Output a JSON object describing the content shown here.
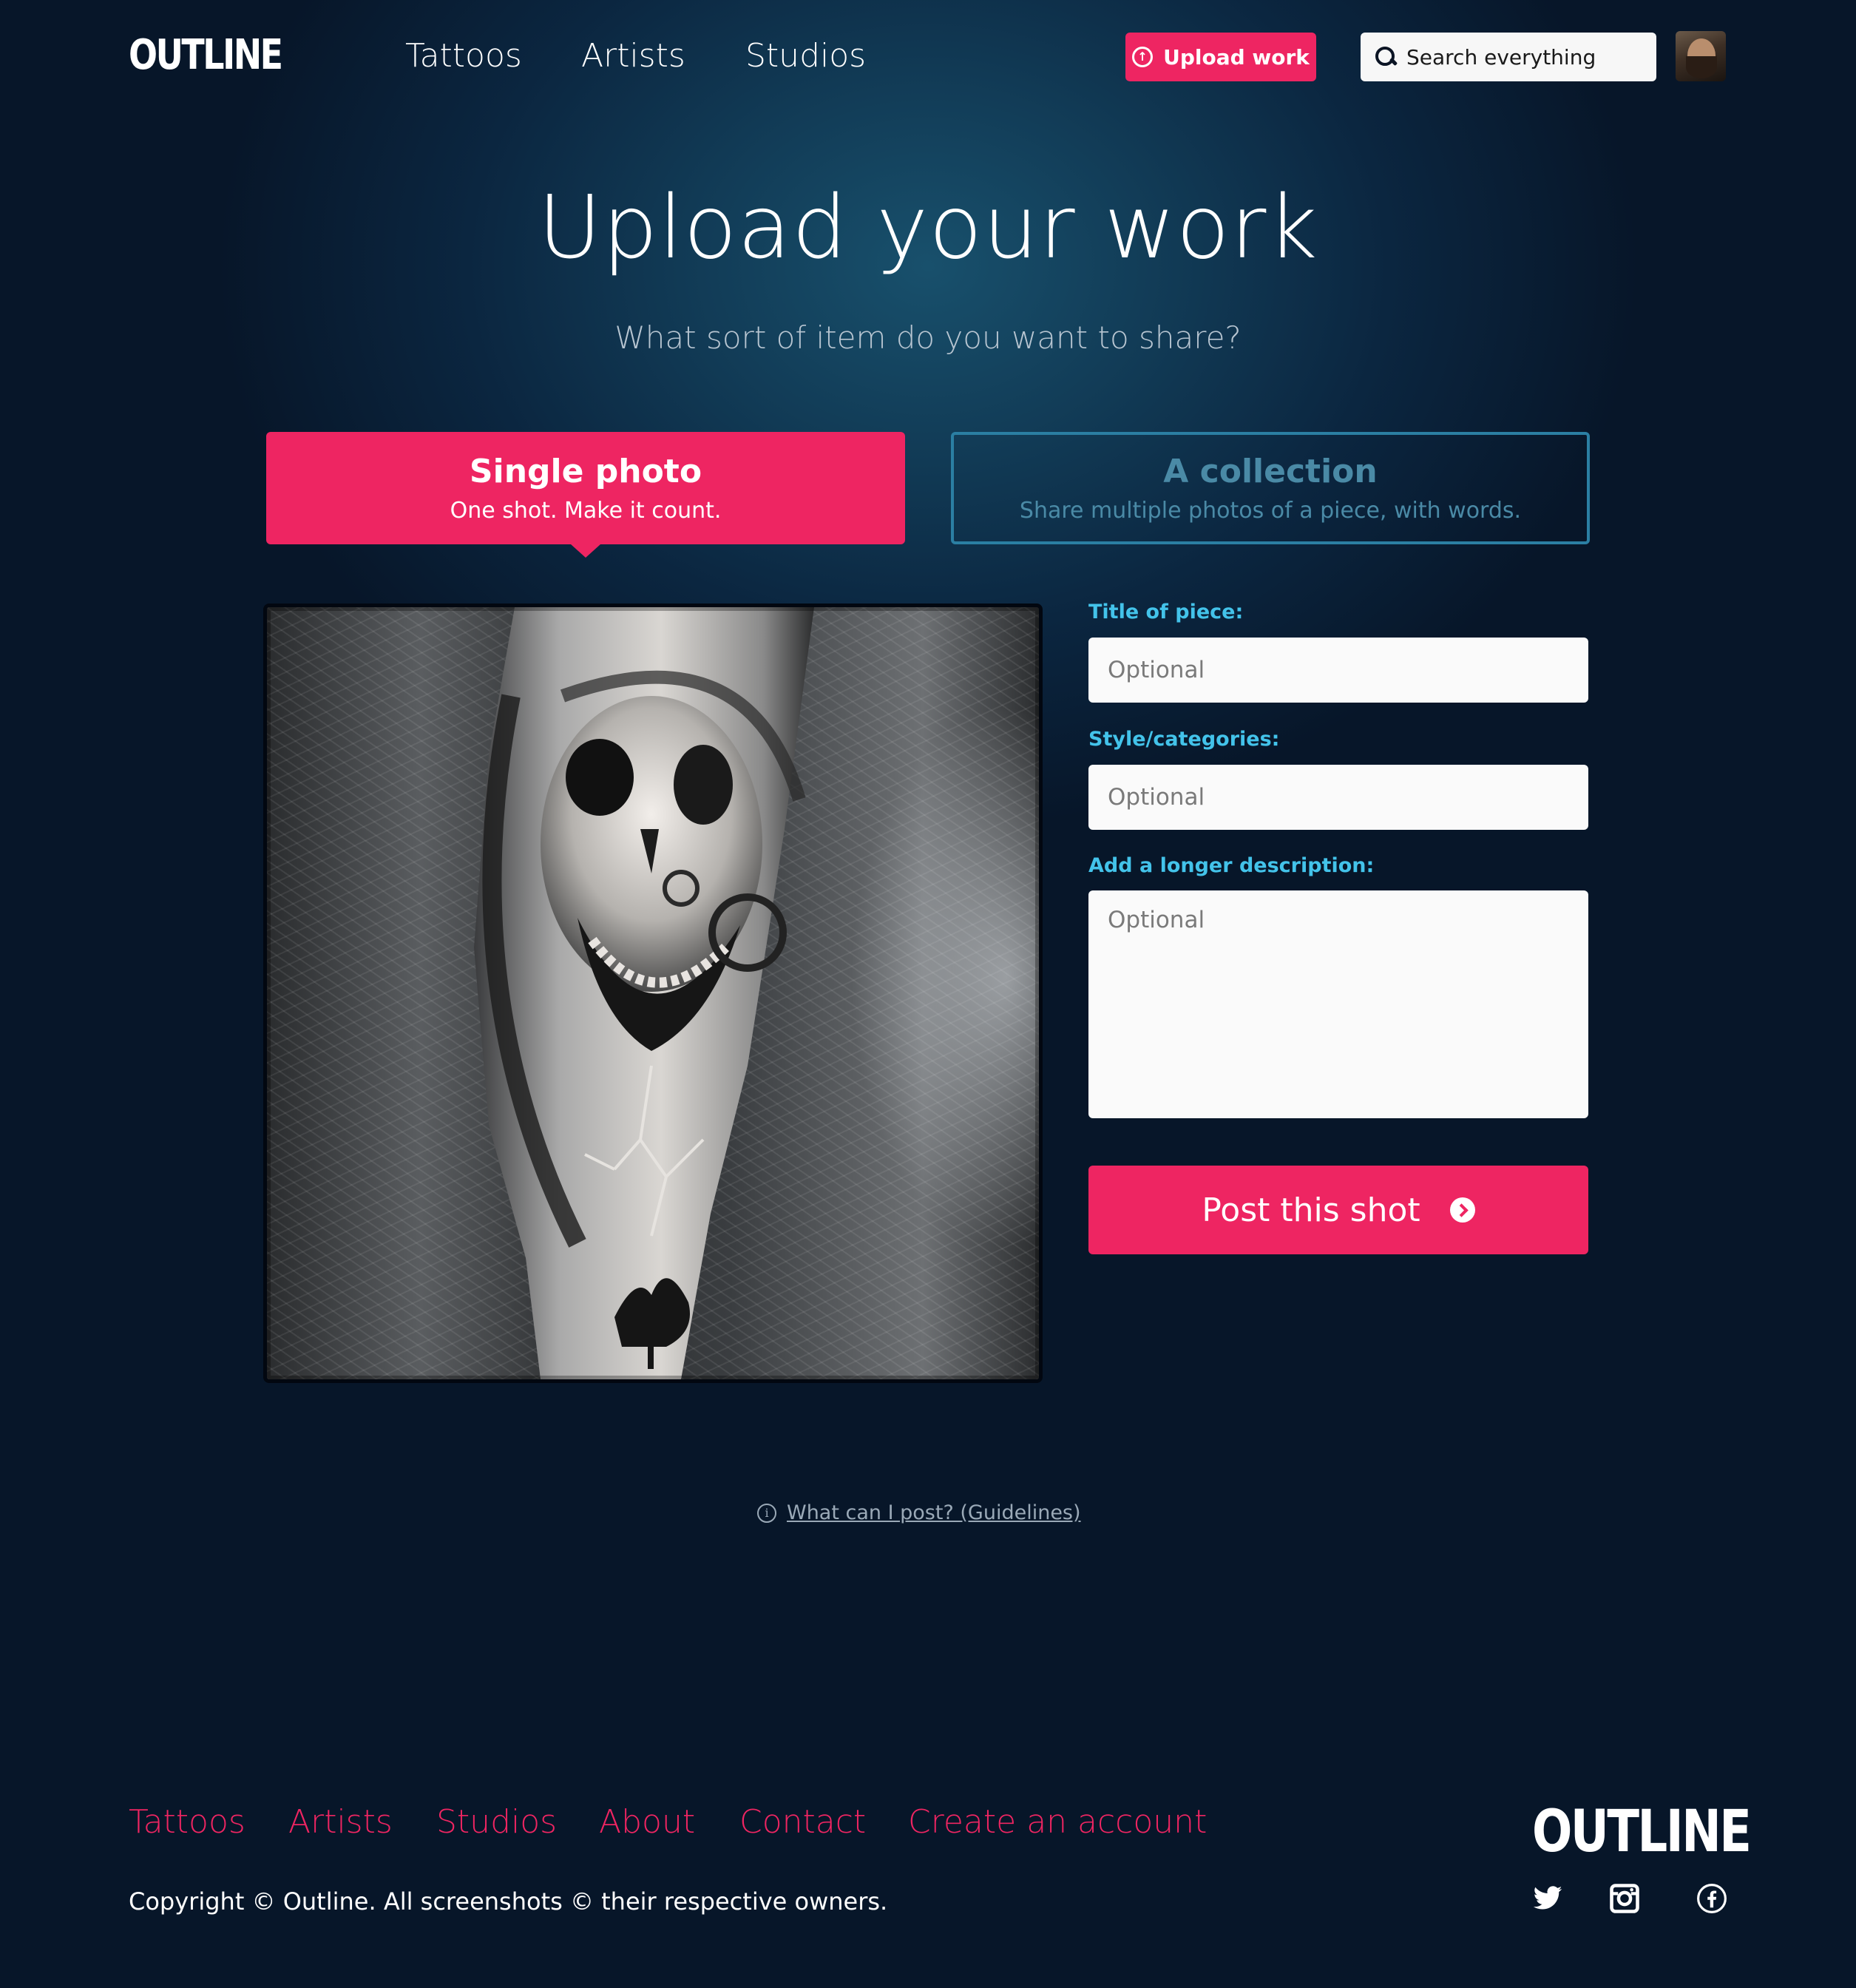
{
  "header": {
    "logo": "OUTLINE",
    "nav": [
      "Tattoos",
      "Artists",
      "Studios"
    ],
    "upload_label": "Upload work",
    "search_placeholder": "Search everything"
  },
  "hero": {
    "title": "Upload your work",
    "subtitle": "What sort of item do you want to share?"
  },
  "types": {
    "single": {
      "title": "Single photo",
      "desc": "One shot. Make it count."
    },
    "collection": {
      "title": "A collection",
      "desc": "Share multiple photos of a piece, with words."
    }
  },
  "form": {
    "title_label": "Title of piece:",
    "title_placeholder": "Optional",
    "style_label": "Style/categories:",
    "style_placeholder": "Optional",
    "desc_label": "Add a longer description:",
    "desc_placeholder": "Optional",
    "post_label": "Post this shot"
  },
  "guidelines": {
    "link": "What can I post? (Guidelines)"
  },
  "footer": {
    "links": [
      "Tattoos",
      "Artists",
      "Studios",
      "About",
      "Contact",
      "Create an account"
    ],
    "copyright": "Copyright © Outline. All screenshots © their respective owners.",
    "logo": "OUTLINE",
    "social_icons": [
      "twitter-icon",
      "instagram-icon",
      "facebook-icon"
    ]
  },
  "colors": {
    "accent": "#ee2562",
    "label": "#43c3ea",
    "background": "#071629",
    "inactive_border": "#2b7fa3"
  }
}
